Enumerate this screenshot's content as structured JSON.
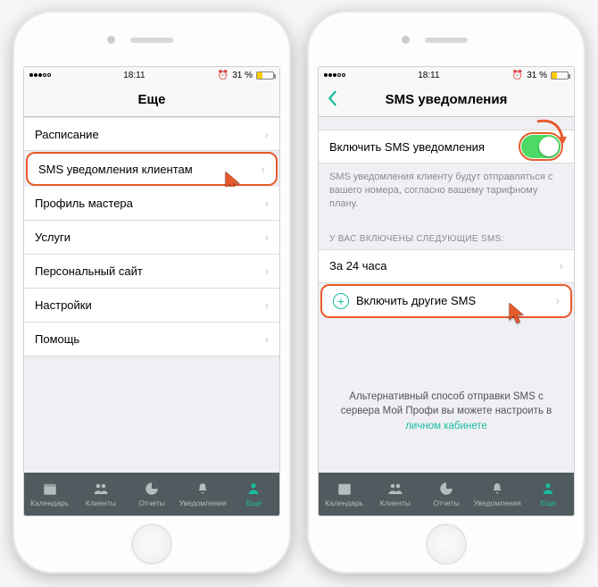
{
  "status": {
    "time": "18:11",
    "battery_pct": "31 %",
    "alarm_icon": "alarm-icon",
    "bt_icon": "bluetooth-icon"
  },
  "left": {
    "title": "Еще",
    "menu": [
      "Расписание",
      "SMS уведомления клиентам",
      "Профиль мастера",
      "Услуги",
      "Персональный сайт",
      "Настройки",
      "Помощь"
    ],
    "highlight_index": 1
  },
  "right": {
    "title": "SMS уведомления",
    "toggle_label": "Включить SMS уведомления",
    "toggle_on": true,
    "note": "SMS уведомления клиенту будут отправляться с вашего номера, согласно вашему тарифному плану.",
    "section_header": "У ВАС ВКЛЮЧЕНЫ СЛЕДУЮЩИЕ SMS:",
    "active_sms": [
      "За 24 часа"
    ],
    "add_other_label": "Включить другие SMS",
    "alt_note_prefix": "Альтернативный способ отправки SMS с сервера Мой Профи вы можете настроить в ",
    "alt_note_link": "личном кабинете"
  },
  "tabs": [
    {
      "label": "Календарь",
      "icon": "calendar-icon"
    },
    {
      "label": "Клиенты",
      "icon": "clients-icon"
    },
    {
      "label": "Отчеты",
      "icon": "reports-icon"
    },
    {
      "label": "Уведомления",
      "icon": "notifications-icon"
    },
    {
      "label": "Еще",
      "icon": "more-icon"
    }
  ],
  "active_tab_index": 4,
  "colors": {
    "accent": "#1abc9c",
    "highlight": "#e85a2b",
    "toggle_on": "#4cd964",
    "tabbar_bg": "#4f5b5e"
  }
}
